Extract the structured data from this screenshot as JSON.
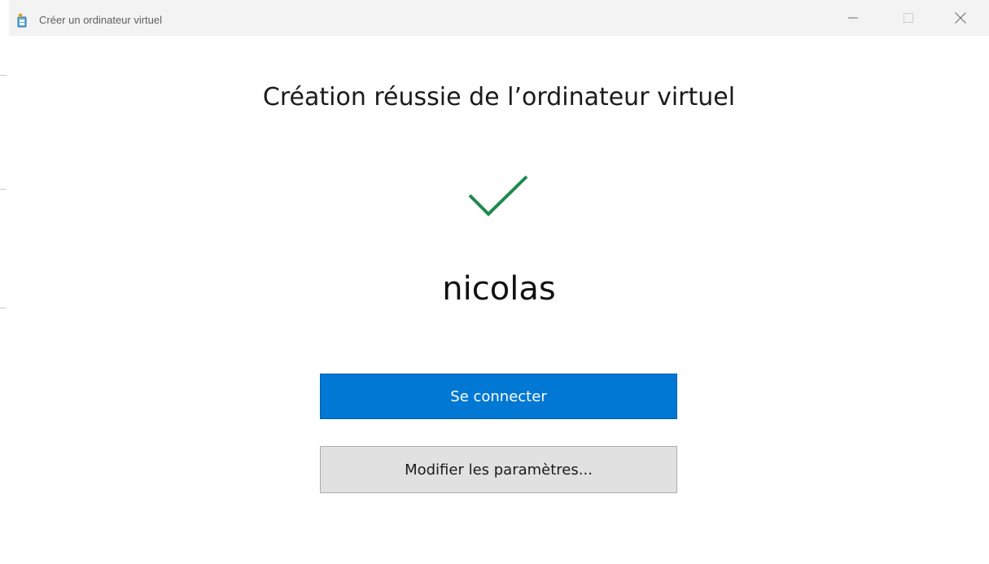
{
  "window": {
    "title": "Créer un ordinateur virtuel"
  },
  "icons": {
    "app": "virtual-machine-creator-icon",
    "minimize": "minimize-icon",
    "maximize": "maximize-icon",
    "close": "close-icon",
    "success": "checkmark-icon"
  },
  "main": {
    "heading": "Création réussie de l’ordinateur virtuel",
    "vm_name": "nicolas",
    "connect_label": "Se connecter",
    "edit_settings_label": "Modifier les paramètres..."
  },
  "colors": {
    "accent": "#0078d4",
    "success": "#1e8a4c",
    "secondary_button": "#e1e1e1"
  }
}
